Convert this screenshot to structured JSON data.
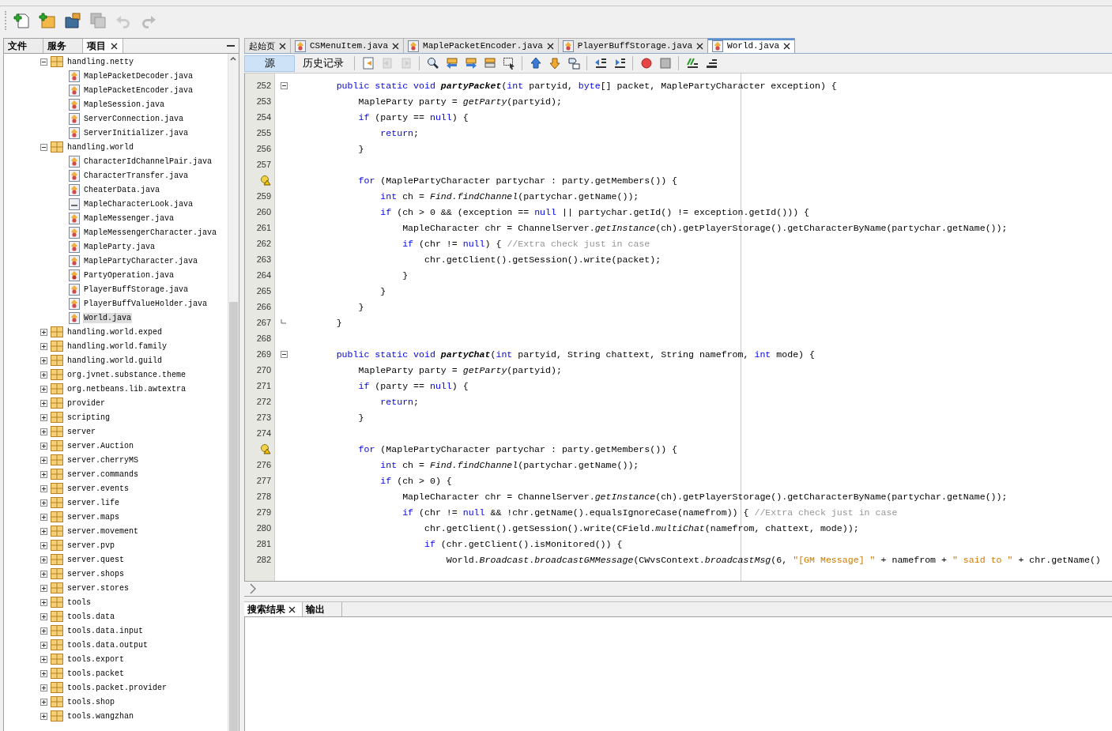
{
  "toolbar": {
    "buttons": [
      {
        "kind": "new-file",
        "disabled": false
      },
      {
        "kind": "new-project",
        "disabled": false
      },
      {
        "kind": "open-project",
        "disabled": false
      },
      {
        "kind": "save-all",
        "disabled": true
      },
      {
        "kind": "undo",
        "disabled": true
      },
      {
        "kind": "redo",
        "disabled": true
      }
    ]
  },
  "project_panel": {
    "tabs": [
      {
        "label": "文件",
        "selected": false,
        "closable": false
      },
      {
        "label": "服务",
        "selected": false,
        "closable": false
      },
      {
        "label": "项目",
        "selected": true,
        "closable": true
      }
    ],
    "tree": [
      {
        "kind": "package",
        "label": "handling.netty",
        "expanded": true,
        "selected": false,
        "children": [
          {
            "kind": "class",
            "label": "MaplePacketDecoder.java",
            "selected": false
          },
          {
            "kind": "class",
            "label": "MaplePacketEncoder.java",
            "selected": false
          },
          {
            "kind": "class",
            "label": "MapleSession.java",
            "selected": false
          },
          {
            "kind": "class",
            "label": "ServerConnection.java",
            "selected": false
          },
          {
            "kind": "class",
            "label": "ServerInitializer.java",
            "selected": false
          }
        ]
      },
      {
        "kind": "package",
        "label": "handling.world",
        "expanded": true,
        "selected": false,
        "children": [
          {
            "kind": "class",
            "label": "CharacterIdChannelPair.java",
            "selected": false
          },
          {
            "kind": "class",
            "label": "CharacterTransfer.java",
            "selected": false
          },
          {
            "kind": "class",
            "label": "CheaterData.java",
            "selected": false
          },
          {
            "kind": "interface",
            "label": "MapleCharacterLook.java",
            "selected": false
          },
          {
            "kind": "class",
            "label": "MapleMessenger.java",
            "selected": false
          },
          {
            "kind": "class",
            "label": "MapleMessengerCharacter.java",
            "selected": false
          },
          {
            "kind": "class",
            "label": "MapleParty.java",
            "selected": false
          },
          {
            "kind": "class",
            "label": "MaplePartyCharacter.java",
            "selected": false
          },
          {
            "kind": "enum",
            "label": "PartyOperation.java",
            "selected": false
          },
          {
            "kind": "class",
            "label": "PlayerBuffStorage.java",
            "selected": false
          },
          {
            "kind": "class",
            "label": "PlayerBuffValueHolder.java",
            "selected": false
          },
          {
            "kind": "class",
            "label": "World.java",
            "selected": true
          }
        ]
      },
      {
        "kind": "package",
        "label": "handling.world.exped",
        "expanded": false,
        "selected": false
      },
      {
        "kind": "package",
        "label": "handling.world.family",
        "expanded": false,
        "selected": false
      },
      {
        "kind": "package",
        "label": "handling.world.guild",
        "expanded": false,
        "selected": false
      },
      {
        "kind": "package",
        "label": "org.jvnet.substance.theme",
        "expanded": false,
        "selected": false
      },
      {
        "kind": "package",
        "label": "org.netbeans.lib.awtextra",
        "expanded": false,
        "selected": false
      },
      {
        "kind": "package",
        "label": "provider",
        "expanded": false,
        "selected": false
      },
      {
        "kind": "package",
        "label": "scripting",
        "expanded": false,
        "selected": false
      },
      {
        "kind": "package",
        "label": "server",
        "expanded": false,
        "selected": false
      },
      {
        "kind": "package",
        "label": "server.Auction",
        "expanded": false,
        "selected": false
      },
      {
        "kind": "package",
        "label": "server.cherryMS",
        "expanded": false,
        "selected": false
      },
      {
        "kind": "package",
        "label": "server.commands",
        "expanded": false,
        "selected": false
      },
      {
        "kind": "package",
        "label": "server.events",
        "expanded": false,
        "selected": false
      },
      {
        "kind": "package",
        "label": "server.life",
        "expanded": false,
        "selected": false
      },
      {
        "kind": "package",
        "label": "server.maps",
        "expanded": false,
        "selected": false
      },
      {
        "kind": "package",
        "label": "server.movement",
        "expanded": false,
        "selected": false
      },
      {
        "kind": "package",
        "label": "server.pvp",
        "expanded": false,
        "selected": false
      },
      {
        "kind": "package",
        "label": "server.quest",
        "expanded": false,
        "selected": false
      },
      {
        "kind": "package",
        "label": "server.shops",
        "expanded": false,
        "selected": false
      },
      {
        "kind": "package",
        "label": "server.stores",
        "expanded": false,
        "selected": false
      },
      {
        "kind": "package",
        "label": "tools",
        "expanded": false,
        "selected": false
      },
      {
        "kind": "package",
        "label": "tools.data",
        "expanded": false,
        "selected": false
      },
      {
        "kind": "package",
        "label": "tools.data.input",
        "expanded": false,
        "selected": false
      },
      {
        "kind": "package",
        "label": "tools.data.output",
        "expanded": false,
        "selected": false
      },
      {
        "kind": "package",
        "label": "tools.export",
        "expanded": false,
        "selected": false
      },
      {
        "kind": "package",
        "label": "tools.packet",
        "expanded": false,
        "selected": false
      },
      {
        "kind": "package",
        "label": "tools.packet.provider",
        "expanded": false,
        "selected": false
      },
      {
        "kind": "package",
        "label": "tools.shop",
        "expanded": false,
        "selected": false
      },
      {
        "kind": "package",
        "label": "tools.wangzhan",
        "expanded": false,
        "selected": false
      }
    ]
  },
  "editor": {
    "tabs": [
      {
        "label": "起始页",
        "kind": "page",
        "selected": false
      },
      {
        "label": "CSMenuItem.java",
        "kind": "java",
        "selected": false
      },
      {
        "label": "MaplePacketEncoder.java",
        "kind": "java",
        "selected": false
      },
      {
        "label": "PlayerBuffStorage.java",
        "kind": "java",
        "selected": false
      },
      {
        "label": "World.java",
        "kind": "java",
        "selected": true
      }
    ],
    "view_tabs": [
      {
        "label": "源",
        "selected": true
      },
      {
        "label": "历史记录",
        "selected": false
      }
    ],
    "tool_groups": [
      [
        {
          "kind": "last-edit",
          "disabled": false
        },
        {
          "kind": "back",
          "disabled": true
        },
        {
          "kind": "forward",
          "disabled": true
        }
      ],
      [
        {
          "kind": "find",
          "disabled": false
        },
        {
          "kind": "find-prev",
          "disabled": false
        },
        {
          "kind": "find-next",
          "disabled": false
        },
        {
          "kind": "highlight",
          "disabled": false
        },
        {
          "kind": "select",
          "disabled": false
        }
      ],
      [
        {
          "kind": "prev-bookmark",
          "disabled": false
        },
        {
          "kind": "next-bookmark",
          "disabled": false
        },
        {
          "kind": "toggle-bookmark",
          "disabled": false
        }
      ],
      [
        {
          "kind": "shift-left",
          "disabled": false
        },
        {
          "kind": "shift-right",
          "disabled": false
        }
      ],
      [
        {
          "kind": "record",
          "disabled": false
        },
        {
          "kind": "stop",
          "disabled": false
        }
      ],
      [
        {
          "kind": "comment",
          "disabled": false
        },
        {
          "kind": "uncomment",
          "disabled": false
        }
      ]
    ],
    "lines": [
      {
        "number": "252",
        "warning": false,
        "expanded": true,
        "tokens": [
          {
            "kind": "kw",
            "text": "public static void "
          },
          {
            "kind": "bold",
            "text": "partyPacket"
          },
          {
            "kind": "plain",
            "text": "("
          },
          {
            "kind": "kw",
            "text": "int"
          },
          {
            "kind": "plain",
            "text": " partyid, "
          },
          {
            "kind": "kw",
            "text": "byte"
          },
          {
            "kind": "plain",
            "text": "[] packet, MaplePartyCharacter exception) {"
          }
        ],
        "children": [
          {
            "number": "253",
            "warning": false,
            "tokens": [
              {
                "kind": "plain",
                "text": "MapleParty party = "
              },
              {
                "kind": "italic",
                "text": "getParty"
              },
              {
                "kind": "plain",
                "text": "(partyid);"
              }
            ]
          },
          {
            "number": "254",
            "warning": false,
            "tokens": [
              {
                "kind": "kw",
                "text": "if"
              },
              {
                "kind": "plain",
                "text": " (party == "
              },
              {
                "kind": "kw",
                "text": "null"
              },
              {
                "kind": "plain",
                "text": ") {"
              }
            ],
            "children": [
              {
                "number": "255",
                "warning": false,
                "tokens": [
                  {
                    "kind": "kw",
                    "text": "return"
                  },
                  {
                    "kind": "plain",
                    "text": ";"
                  }
                ]
              }
            ]
          },
          {
            "number": "256",
            "warning": false,
            "tokens": [
              {
                "kind": "plain",
                "text": "}"
              }
            ]
          },
          {
            "number": "257",
            "warning": false
          },
          {
            "warning": true,
            "tokens": [
              {
                "kind": "kw",
                "text": "for"
              },
              {
                "kind": "plain",
                "text": " (MaplePartyCharacter partychar : party.getMembers()) {"
              }
            ],
            "children": [
              {
                "number": "259",
                "warning": false,
                "tokens": [
                  {
                    "kind": "kw",
                    "text": "int"
                  },
                  {
                    "kind": "plain",
                    "text": " ch = "
                  },
                  {
                    "kind": "italic",
                    "text": "Find.findChannel"
                  },
                  {
                    "kind": "plain",
                    "text": "(partychar.getName());"
                  }
                ]
              },
              {
                "number": "260",
                "warning": false,
                "tokens": [
                  {
                    "kind": "kw",
                    "text": "if"
                  },
                  {
                    "kind": "plain",
                    "text": " (ch > 0 && (exception == "
                  },
                  {
                    "kind": "kw",
                    "text": "null"
                  },
                  {
                    "kind": "plain",
                    "text": " || partychar.getId() != exception.getId())) {"
                  }
                ],
                "children": [
                  {
                    "number": "261",
                    "warning": false,
                    "tokens": [
                      {
                        "kind": "plain",
                        "text": "MapleCharacter chr = ChannelServer."
                      },
                      {
                        "kind": "italic",
                        "text": "getInstance"
                      },
                      {
                        "kind": "plain",
                        "text": "(ch).getPlayerStorage().getCharacterByName(partychar.getName());"
                      }
                    ]
                  },
                  {
                    "number": "262",
                    "warning": false,
                    "tokens": [
                      {
                        "kind": "kw",
                        "text": "if"
                      },
                      {
                        "kind": "plain",
                        "text": " (chr != "
                      },
                      {
                        "kind": "kw",
                        "text": "null"
                      },
                      {
                        "kind": "plain",
                        "text": ") { "
                      },
                      {
                        "kind": "comment",
                        "text": "//Extra check just in case"
                      }
                    ],
                    "children": [
                      {
                        "number": "263",
                        "warning": false,
                        "tokens": [
                          {
                            "kind": "plain",
                            "text": "chr.getClient().getSession().write(packet);"
                          }
                        ]
                      }
                    ]
                  },
                  {
                    "number": "264",
                    "warning": false,
                    "tokens": [
                      {
                        "kind": "plain",
                        "text": "}"
                      }
                    ]
                  }
                ]
              },
              {
                "number": "265",
                "warning": false,
                "tokens": [
                  {
                    "kind": "plain",
                    "text": "}"
                  }
                ]
              }
            ]
          },
          {
            "number": "266",
            "warning": false,
            "tokens": [
              {
                "kind": "plain",
                "text": "}"
              }
            ]
          }
        ]
      },
      {
        "number": "267",
        "warning": false,
        "tokens": [
          {
            "kind": "plain",
            "text": "}"
          }
        ]
      },
      {
        "number": "268",
        "warning": false
      },
      {
        "number": "269",
        "warning": false,
        "expanded": true,
        "tokens": [
          {
            "kind": "kw",
            "text": "public static void "
          },
          {
            "kind": "bold",
            "text": "partyChat"
          },
          {
            "kind": "plain",
            "text": "("
          },
          {
            "kind": "kw",
            "text": "int"
          },
          {
            "kind": "plain",
            "text": " partyid, String chattext, String namefrom, "
          },
          {
            "kind": "kw",
            "text": "int"
          },
          {
            "kind": "plain",
            "text": " mode) {"
          }
        ],
        "children": [
          {
            "number": "270",
            "warning": false,
            "tokens": [
              {
                "kind": "plain",
                "text": "MapleParty party = "
              },
              {
                "kind": "italic",
                "text": "getParty"
              },
              {
                "kind": "plain",
                "text": "(partyid);"
              }
            ]
          },
          {
            "number": "271",
            "warning": false,
            "tokens": [
              {
                "kind": "kw",
                "text": "if"
              },
              {
                "kind": "plain",
                "text": " (party == "
              },
              {
                "kind": "kw",
                "text": "null"
              },
              {
                "kind": "plain",
                "text": ") {"
              }
            ],
            "children": [
              {
                "number": "272",
                "warning": false,
                "tokens": [
                  {
                    "kind": "kw",
                    "text": "return"
                  },
                  {
                    "kind": "plain",
                    "text": ";"
                  }
                ]
              }
            ]
          },
          {
            "number": "273",
            "warning": false,
            "tokens": [
              {
                "kind": "plain",
                "text": "}"
              }
            ]
          },
          {
            "number": "274",
            "warning": false
          },
          {
            "warning": true,
            "tokens": [
              {
                "kind": "kw",
                "text": "for"
              },
              {
                "kind": "plain",
                "text": " (MaplePartyCharacter partychar : party.getMembers()) {"
              }
            ],
            "children": [
              {
                "number": "276",
                "warning": false,
                "tokens": [
                  {
                    "kind": "kw",
                    "text": "int"
                  },
                  {
                    "kind": "plain",
                    "text": " ch = "
                  },
                  {
                    "kind": "italic",
                    "text": "Find.findChannel"
                  },
                  {
                    "kind": "plain",
                    "text": "(partychar.getName());"
                  }
                ]
              },
              {
                "number": "277",
                "warning": false,
                "tokens": [
                  {
                    "kind": "kw",
                    "text": "if"
                  },
                  {
                    "kind": "plain",
                    "text": " (ch > 0) {"
                  }
                ],
                "children": [
                  {
                    "number": "278",
                    "warning": false,
                    "tokens": [
                      {
                        "kind": "plain",
                        "text": "MapleCharacter chr = ChannelServer."
                      },
                      {
                        "kind": "italic",
                        "text": "getInstance"
                      },
                      {
                        "kind": "plain",
                        "text": "(ch).getPlayerStorage().getCharacterByName(partychar.getName());"
                      }
                    ]
                  },
                  {
                    "number": "279",
                    "warning": false,
                    "tokens": [
                      {
                        "kind": "kw",
                        "text": "if"
                      },
                      {
                        "kind": "plain",
                        "text": " (chr != "
                      },
                      {
                        "kind": "kw",
                        "text": "null"
                      },
                      {
                        "kind": "plain",
                        "text": " && !chr.getName().equalsIgnoreCase(namefrom)) { "
                      },
                      {
                        "kind": "comment",
                        "text": "//Extra check just in case"
                      }
                    ],
                    "children": [
                      {
                        "number": "280",
                        "warning": false,
                        "tokens": [
                          {
                            "kind": "plain",
                            "text": "chr.getClient().getSession().write(CField."
                          },
                          {
                            "kind": "italic",
                            "text": "multiChat"
                          },
                          {
                            "kind": "plain",
                            "text": "(namefrom, chattext, mode));"
                          }
                        ]
                      },
                      {
                        "number": "281",
                        "warning": false,
                        "tokens": [
                          {
                            "kind": "kw",
                            "text": "if"
                          },
                          {
                            "kind": "plain",
                            "text": " (chr.getClient().isMonitored()) {"
                          }
                        ],
                        "children": [
                          {
                            "number": "282",
                            "warning": false,
                            "tokens": [
                              {
                                "kind": "plain",
                                "text": "World."
                              },
                              {
                                "kind": "italic",
                                "text": "Broadcast"
                              },
                              {
                                "kind": "plain",
                                "text": "."
                              },
                              {
                                "kind": "italic",
                                "text": "broadcastGMMessage"
                              },
                              {
                                "kind": "plain",
                                "text": "(CWvsContext."
                              },
                              {
                                "kind": "italic",
                                "text": "broadcastMsg"
                              },
                              {
                                "kind": "plain",
                                "text": "(6, "
                              },
                              {
                                "kind": "string",
                                "text": "\"[GM Message] \""
                              },
                              {
                                "kind": "plain",
                                "text": " + namefrom + "
                              },
                              {
                                "kind": "string",
                                "text": "\" said to \""
                              },
                              {
                                "kind": "plain",
                                "text": " + chr.getName()"
                              }
                            ]
                          }
                        ]
                      }
                    ]
                  }
                ]
              }
            ]
          }
        ]
      }
    ]
  },
  "output_panel": {
    "tabs": [
      {
        "label": "搜索结果",
        "selected": true,
        "closable": true
      },
      {
        "label": "输出",
        "selected": false,
        "closable": false
      }
    ]
  }
}
